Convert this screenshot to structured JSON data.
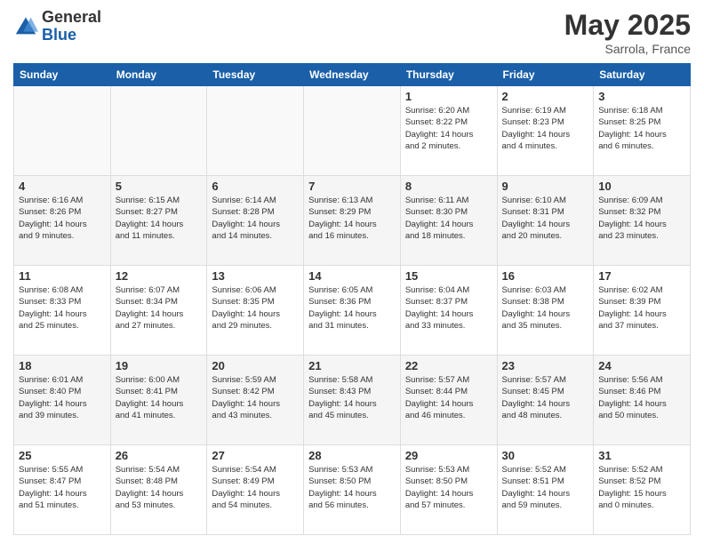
{
  "header": {
    "logo_general": "General",
    "logo_blue": "Blue",
    "title": "May 2025",
    "subtitle": "Sarrola, France"
  },
  "days_of_week": [
    "Sunday",
    "Monday",
    "Tuesday",
    "Wednesday",
    "Thursday",
    "Friday",
    "Saturday"
  ],
  "weeks": [
    [
      {
        "day": "",
        "info": ""
      },
      {
        "day": "",
        "info": ""
      },
      {
        "day": "",
        "info": ""
      },
      {
        "day": "",
        "info": ""
      },
      {
        "day": "1",
        "info": "Sunrise: 6:20 AM\nSunset: 8:22 PM\nDaylight: 14 hours\nand 2 minutes."
      },
      {
        "day": "2",
        "info": "Sunrise: 6:19 AM\nSunset: 8:23 PM\nDaylight: 14 hours\nand 4 minutes."
      },
      {
        "day": "3",
        "info": "Sunrise: 6:18 AM\nSunset: 8:25 PM\nDaylight: 14 hours\nand 6 minutes."
      }
    ],
    [
      {
        "day": "4",
        "info": "Sunrise: 6:16 AM\nSunset: 8:26 PM\nDaylight: 14 hours\nand 9 minutes."
      },
      {
        "day": "5",
        "info": "Sunrise: 6:15 AM\nSunset: 8:27 PM\nDaylight: 14 hours\nand 11 minutes."
      },
      {
        "day": "6",
        "info": "Sunrise: 6:14 AM\nSunset: 8:28 PM\nDaylight: 14 hours\nand 14 minutes."
      },
      {
        "day": "7",
        "info": "Sunrise: 6:13 AM\nSunset: 8:29 PM\nDaylight: 14 hours\nand 16 minutes."
      },
      {
        "day": "8",
        "info": "Sunrise: 6:11 AM\nSunset: 8:30 PM\nDaylight: 14 hours\nand 18 minutes."
      },
      {
        "day": "9",
        "info": "Sunrise: 6:10 AM\nSunset: 8:31 PM\nDaylight: 14 hours\nand 20 minutes."
      },
      {
        "day": "10",
        "info": "Sunrise: 6:09 AM\nSunset: 8:32 PM\nDaylight: 14 hours\nand 23 minutes."
      }
    ],
    [
      {
        "day": "11",
        "info": "Sunrise: 6:08 AM\nSunset: 8:33 PM\nDaylight: 14 hours\nand 25 minutes."
      },
      {
        "day": "12",
        "info": "Sunrise: 6:07 AM\nSunset: 8:34 PM\nDaylight: 14 hours\nand 27 minutes."
      },
      {
        "day": "13",
        "info": "Sunrise: 6:06 AM\nSunset: 8:35 PM\nDaylight: 14 hours\nand 29 minutes."
      },
      {
        "day": "14",
        "info": "Sunrise: 6:05 AM\nSunset: 8:36 PM\nDaylight: 14 hours\nand 31 minutes."
      },
      {
        "day": "15",
        "info": "Sunrise: 6:04 AM\nSunset: 8:37 PM\nDaylight: 14 hours\nand 33 minutes."
      },
      {
        "day": "16",
        "info": "Sunrise: 6:03 AM\nSunset: 8:38 PM\nDaylight: 14 hours\nand 35 minutes."
      },
      {
        "day": "17",
        "info": "Sunrise: 6:02 AM\nSunset: 8:39 PM\nDaylight: 14 hours\nand 37 minutes."
      }
    ],
    [
      {
        "day": "18",
        "info": "Sunrise: 6:01 AM\nSunset: 8:40 PM\nDaylight: 14 hours\nand 39 minutes."
      },
      {
        "day": "19",
        "info": "Sunrise: 6:00 AM\nSunset: 8:41 PM\nDaylight: 14 hours\nand 41 minutes."
      },
      {
        "day": "20",
        "info": "Sunrise: 5:59 AM\nSunset: 8:42 PM\nDaylight: 14 hours\nand 43 minutes."
      },
      {
        "day": "21",
        "info": "Sunrise: 5:58 AM\nSunset: 8:43 PM\nDaylight: 14 hours\nand 45 minutes."
      },
      {
        "day": "22",
        "info": "Sunrise: 5:57 AM\nSunset: 8:44 PM\nDaylight: 14 hours\nand 46 minutes."
      },
      {
        "day": "23",
        "info": "Sunrise: 5:57 AM\nSunset: 8:45 PM\nDaylight: 14 hours\nand 48 minutes."
      },
      {
        "day": "24",
        "info": "Sunrise: 5:56 AM\nSunset: 8:46 PM\nDaylight: 14 hours\nand 50 minutes."
      }
    ],
    [
      {
        "day": "25",
        "info": "Sunrise: 5:55 AM\nSunset: 8:47 PM\nDaylight: 14 hours\nand 51 minutes."
      },
      {
        "day": "26",
        "info": "Sunrise: 5:54 AM\nSunset: 8:48 PM\nDaylight: 14 hours\nand 53 minutes."
      },
      {
        "day": "27",
        "info": "Sunrise: 5:54 AM\nSunset: 8:49 PM\nDaylight: 14 hours\nand 54 minutes."
      },
      {
        "day": "28",
        "info": "Sunrise: 5:53 AM\nSunset: 8:50 PM\nDaylight: 14 hours\nand 56 minutes."
      },
      {
        "day": "29",
        "info": "Sunrise: 5:53 AM\nSunset: 8:50 PM\nDaylight: 14 hours\nand 57 minutes."
      },
      {
        "day": "30",
        "info": "Sunrise: 5:52 AM\nSunset: 8:51 PM\nDaylight: 14 hours\nand 59 minutes."
      },
      {
        "day": "31",
        "info": "Sunrise: 5:52 AM\nSunset: 8:52 PM\nDaylight: 15 hours\nand 0 minutes."
      }
    ]
  ]
}
